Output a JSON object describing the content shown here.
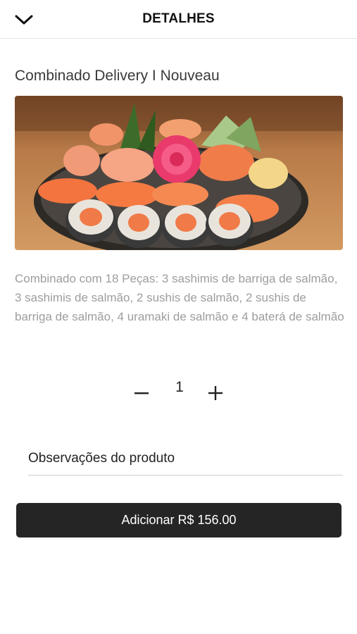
{
  "header": {
    "title": "DETALHES",
    "back_icon": "chevron-down-icon"
  },
  "product": {
    "name": "Combinado Delivery I Nouveau",
    "image": "sushi-combo-photo",
    "description": "Combinado com 18 Peças: 3 sashimis de barriga de salmão, 3 sashimis de salmão, 2 sushis de salmão, 2 sushis de barriga de salmão, 4 uramaki de salmão e 4 baterá de salmão"
  },
  "quantity": {
    "value": "1",
    "minus_icon": "minus-icon",
    "plus_icon": "plus-icon"
  },
  "notes": {
    "placeholder": "Observações do produto",
    "value": ""
  },
  "add_button": {
    "label": "Adicionar R$ 156.00"
  },
  "colors": {
    "button_bg": "#252525",
    "button_text": "#ffffff",
    "description_text": "#9d9d9d"
  }
}
